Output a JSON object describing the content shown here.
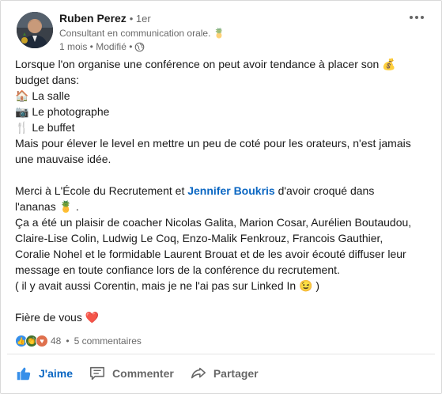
{
  "post": {
    "author": {
      "name": "Ruben Perez",
      "degree": "• 1er",
      "headline": "Consultant en communication orale. 🍍",
      "time": "1 mois • Modifié •"
    },
    "text": {
      "l1": "Lorsque l'on organise une conférence on peut avoir tendance à placer son 💰",
      "l2": "budget dans:",
      "l3": "🏠 La salle",
      "l4": "📷 Le photographe",
      "l5": "🍴 Le buffet",
      "l6": "Mais pour élever le level en mettre un peu de coté pour les orateurs, n'est jamais",
      "l7": "une mauvaise idée.",
      "l9a": "Merci à L'École du Recrutement et ",
      "l9_mention": "Jennifer Boukris",
      "l9b": " d'avoir croqué dans",
      "l10": "l'ananas 🍍 .",
      "l11": "Ça a été un plaisir de coacher Nicolas Galita, Marion Cosar, Aurélien Boutaudou,",
      "l12": "Claire-Lise Colin, Ludwig Le Coq, Enzo-Malik Fenkrouz, Francois Gauthier,",
      "l13": "Coralie Nohel et le formidable Laurent Brouat et de les avoir écouté diffuser leur",
      "l14": "message en toute confiance lors de la conférence du recrutement.",
      "l15": "( il y avait aussi Corentin, mais je ne l'ai pas sur Linked In  😉 )",
      "l17": "Fière de vous ❤️"
    },
    "social": {
      "reaction_count": "48",
      "separator": "•",
      "comments": "5 commentaires",
      "reactions": [
        "like-icon",
        "celebrate-icon",
        "love-icon"
      ]
    },
    "actions": {
      "like": "J'aime",
      "comment": "Commenter",
      "share": "Partager"
    },
    "colors": {
      "accent": "#0a66c2",
      "muted": "#666666"
    }
  }
}
